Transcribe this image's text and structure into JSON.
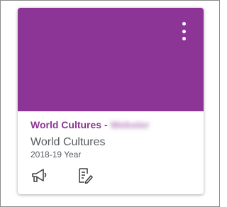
{
  "card": {
    "header_prefix": "World Cultures - ",
    "header_obscured": "Webster",
    "course_name": "World Cultures",
    "term": "2018-19 Year",
    "color": "#8d3596",
    "menu_icon": "more-vertical-icon",
    "actions": [
      {
        "icon": "announcements-icon"
      },
      {
        "icon": "assignments-icon"
      }
    ]
  }
}
